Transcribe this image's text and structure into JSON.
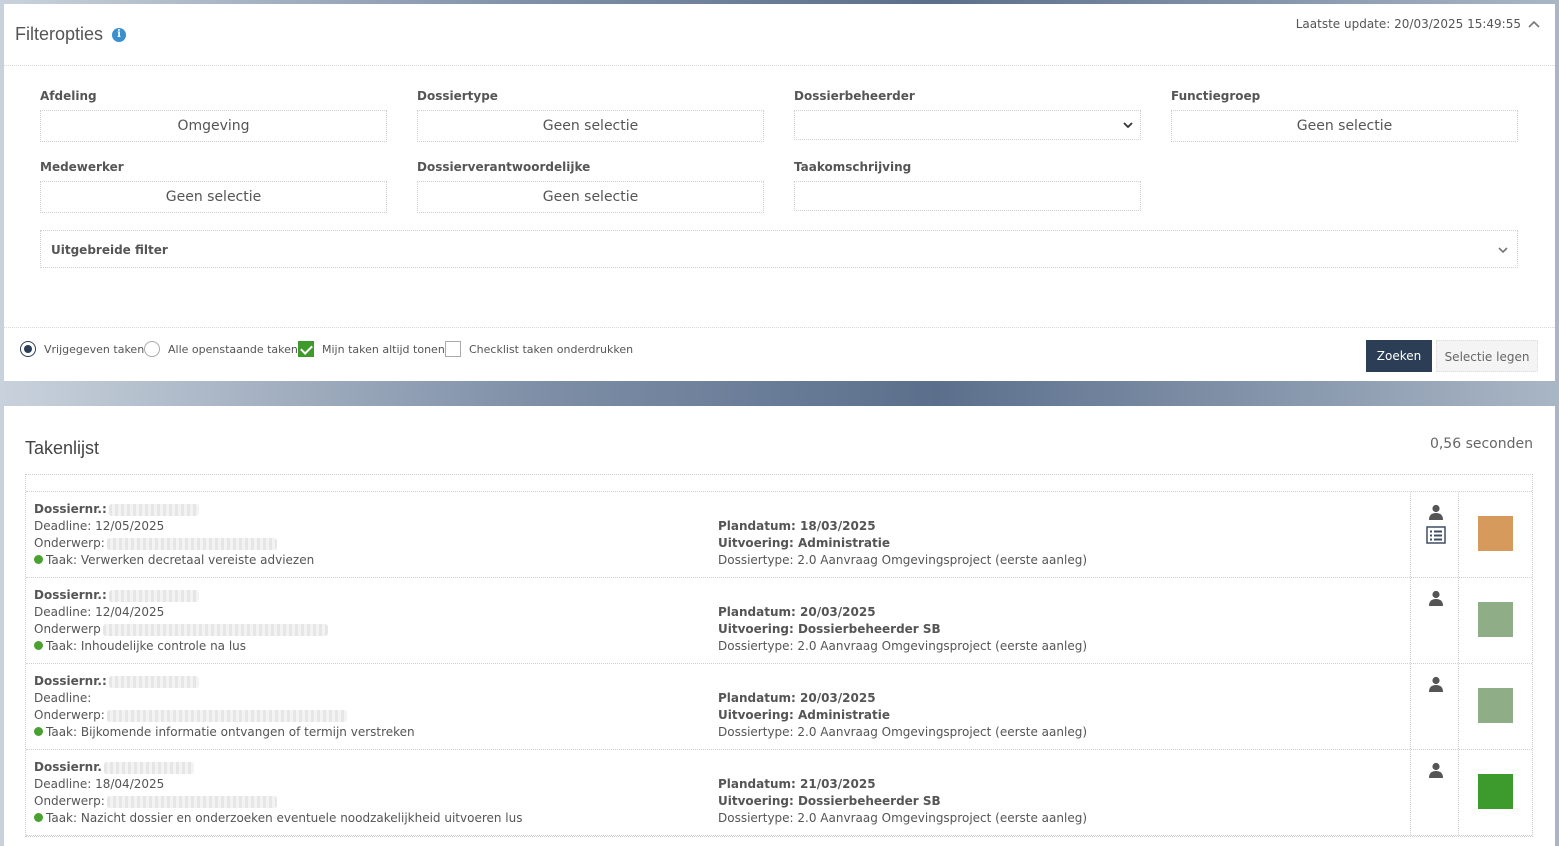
{
  "filter": {
    "title": "Filteropties",
    "info_icon": "i",
    "last_update": "Laatste update: 20/03/2025 15:49:55",
    "fields": {
      "afdeling": {
        "label": "Afdeling",
        "value": "Omgeving"
      },
      "dossiertype": {
        "label": "Dossiertype",
        "value": "Geen selectie"
      },
      "dossierbeheerder": {
        "label": "Dossierbeheerder",
        "value": ""
      },
      "functiegroep": {
        "label": "Functiegroep",
        "value": "Geen selectie"
      },
      "medewerker": {
        "label": "Medewerker",
        "value": "Geen selectie"
      },
      "dossierverantwoordelijke": {
        "label": "Dossierverantwoordelijke",
        "value": "Geen selectie"
      },
      "taakomschrijving": {
        "label": "Taakomschrijving",
        "value": ""
      }
    },
    "advanced_label": "Uitgebreide filter",
    "options": {
      "vrijgegeven": {
        "label": "Vrijgegeven taken",
        "checked": true
      },
      "alle_open": {
        "label": "Alle openstaande taken",
        "checked": false
      },
      "mijn_taken": {
        "label": "Mijn taken altijd tonen",
        "checked": true
      },
      "checklist": {
        "label": "Checklist taken onderdrukken",
        "checked": false
      }
    },
    "search_label": "Zoeken",
    "clear_label": "Selectie legen"
  },
  "tasks": {
    "title": "Takenlijst",
    "elapsed": "0,56 seconden",
    "rows": [
      {
        "dossier_label": "Dossiernr.:",
        "deadline": "Deadline: 12/05/2025",
        "onderwerp_label": "Onderwerp:",
        "taak": "Taak: Verwerken decretaal vereiste adviezen",
        "plandatum": "Plandatum: 18/03/2025",
        "uitvoering": "Uitvoering: Administratie",
        "dossiertype": "Dossiertype: 2.0 Aanvraag Omgevingsproject (eerste aanleg)",
        "color": "#d69a5c"
      },
      {
        "dossier_label": "Dossiernr.:",
        "deadline": "Deadline: 12/04/2025",
        "onderwerp_label": "Onderwerp",
        "taak": "Taak: Inhoudelijke controle na lus",
        "plandatum": "Plandatum: 20/03/2025",
        "uitvoering": "Uitvoering: Dossierbeheerder SB",
        "dossiertype": "Dossiertype: 2.0 Aanvraag Omgevingsproject (eerste aanleg)",
        "color": "#8fae88"
      },
      {
        "dossier_label": "Dossiernr.:",
        "deadline": "Deadline:",
        "onderwerp_label": "Onderwerp:",
        "taak": "Taak: Bijkomende informatie ontvangen of termijn verstreken",
        "plandatum": "Plandatum: 20/03/2025",
        "uitvoering": "Uitvoering: Administratie",
        "dossiertype": "Dossiertype: 2.0 Aanvraag Omgevingsproject (eerste aanleg)",
        "color": "#8fae88"
      },
      {
        "dossier_label": "Dossiernr.",
        "deadline": "Deadline: 18/04/2025",
        "onderwerp_label": "Onderwerp:",
        "taak": "Taak: Nazicht dossier en onderzoeken eventuele noodzakelijkheid uitvoeren lus",
        "plandatum": "Plandatum: 21/03/2025",
        "uitvoering": "Uitvoering: Dossierbeheerder SB",
        "dossiertype": "Dossiertype: 2.0 Aanvraag Omgevingsproject (eerste aanleg)",
        "color": "#3d9a2c"
      }
    ]
  },
  "icons": {
    "info": "info-icon",
    "collapse": "chevron-up-icon",
    "select": "chevron-down-icon",
    "user": "user-icon",
    "list": "list-icon",
    "status": "status-dot-icon"
  }
}
